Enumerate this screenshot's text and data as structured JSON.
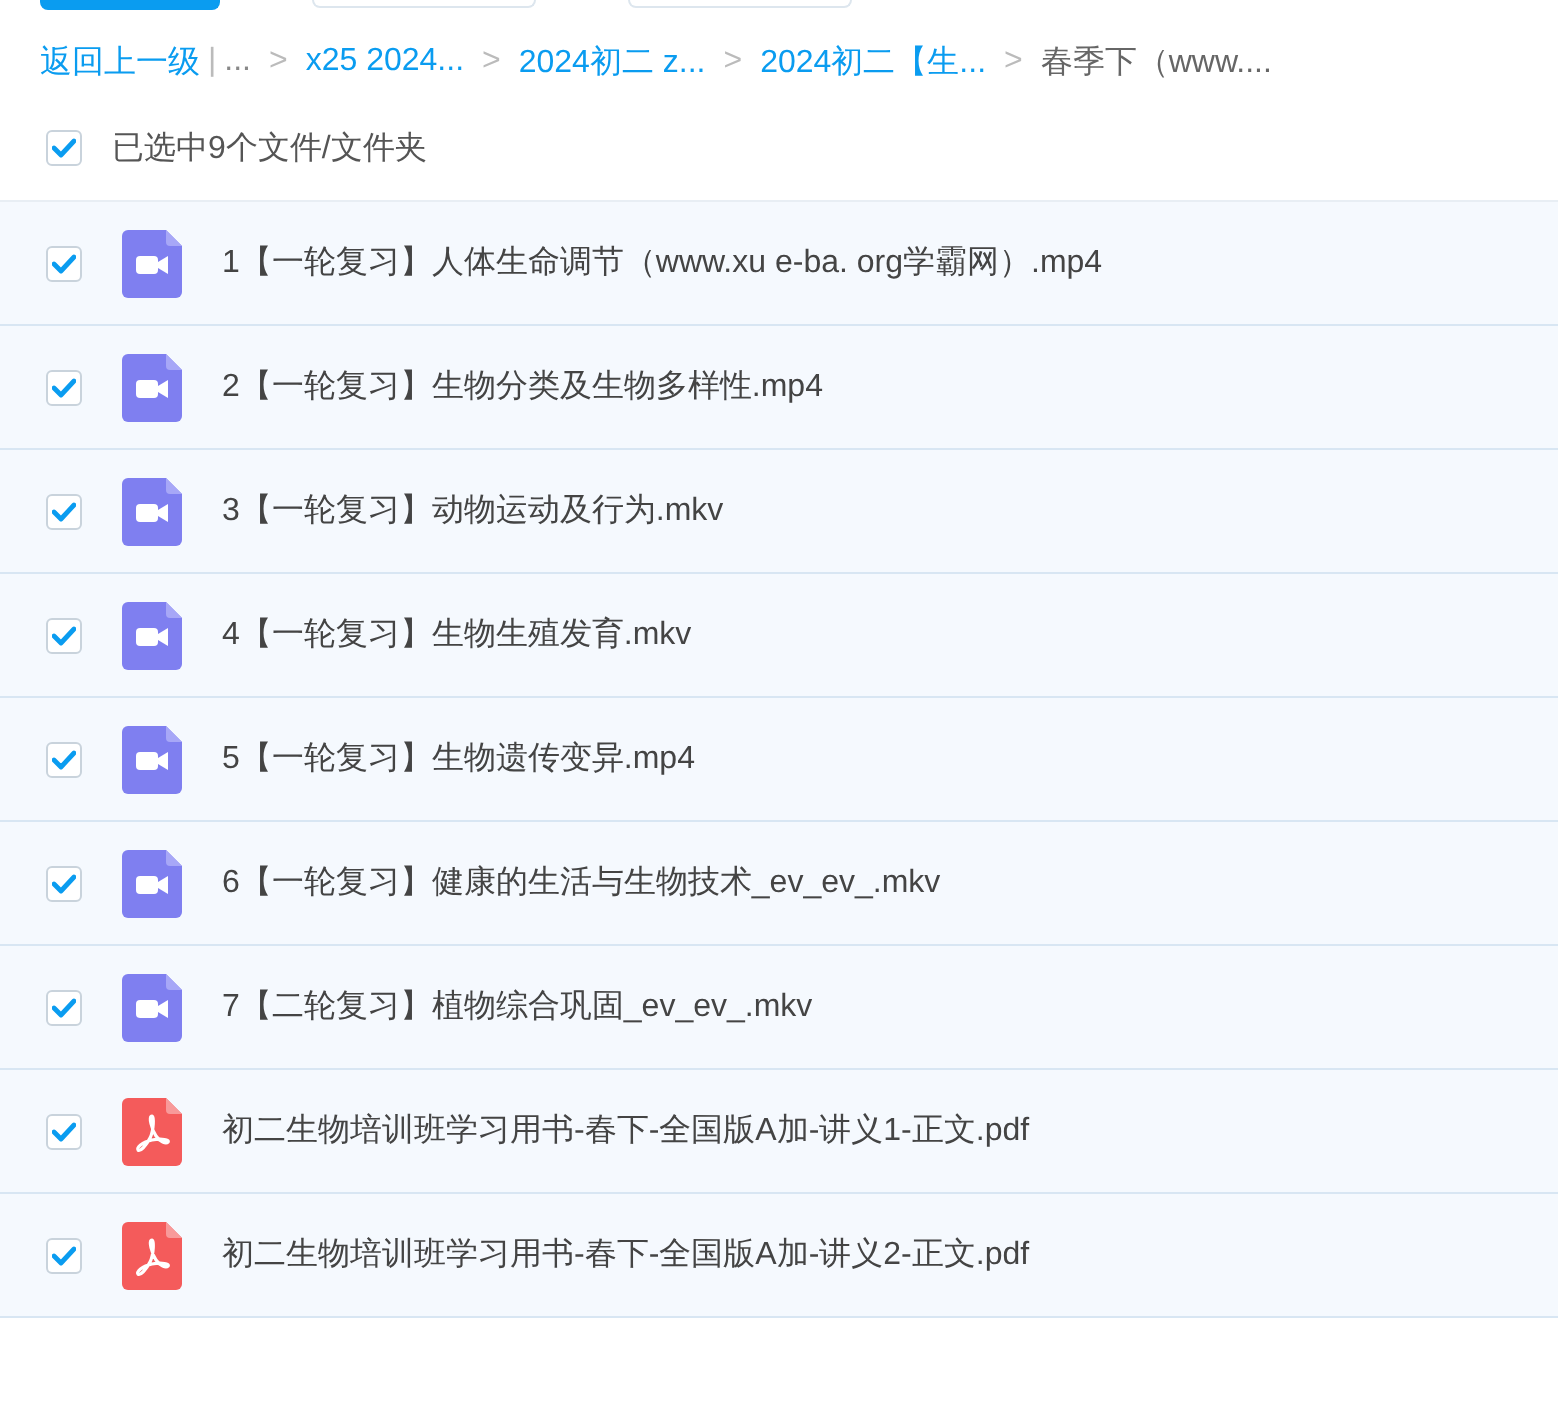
{
  "top_tabs": [
    {
      "selected": true
    },
    {
      "selected": false
    },
    {
      "selected": false
    }
  ],
  "breadcrumb": {
    "back": "返回上一级",
    "divider": "|",
    "items": [
      {
        "label": "...",
        "kind": "ellipsis",
        "separator": ">"
      },
      {
        "label": "x25 2024...",
        "kind": "link",
        "separator": ">"
      },
      {
        "label": "2024初二 z...",
        "kind": "link",
        "separator": ">"
      },
      {
        "label": "2024初二【生...",
        "kind": "link",
        "separator": ">"
      },
      {
        "label": "春季下（www....",
        "kind": "current"
      }
    ]
  },
  "select_all": {
    "checked": true,
    "label": "已选中9个文件/文件夹"
  },
  "files": [
    {
      "kind": "video",
      "checked": true,
      "name": "1【一轮复习】人体生命调节（www.xu e-ba. org学霸网）.mp4"
    },
    {
      "kind": "video",
      "checked": true,
      "name": "2【一轮复习】生物分类及生物多样性.mp4"
    },
    {
      "kind": "video",
      "checked": true,
      "name": "3【一轮复习】动物运动及行为.mkv"
    },
    {
      "kind": "video",
      "checked": true,
      "name": "4【一轮复习】生物生殖发育.mkv"
    },
    {
      "kind": "video",
      "checked": true,
      "name": "5【一轮复习】生物遗传变异.mp4"
    },
    {
      "kind": "video",
      "checked": true,
      "name": "6【一轮复习】健康的生活与生物技术_ev_ev_.mkv"
    },
    {
      "kind": "video",
      "checked": true,
      "name": "7【二轮复习】植物综合巩固_ev_ev_.mkv"
    },
    {
      "kind": "pdf",
      "checked": true,
      "name": "初二生物培训班学习用书-春下-全国版A加-讲义1-正文.pdf"
    },
    {
      "kind": "pdf",
      "checked": true,
      "name": "初二生物培训班学习用书-春下-全国版A加-讲义2-正文.pdf"
    }
  ]
}
